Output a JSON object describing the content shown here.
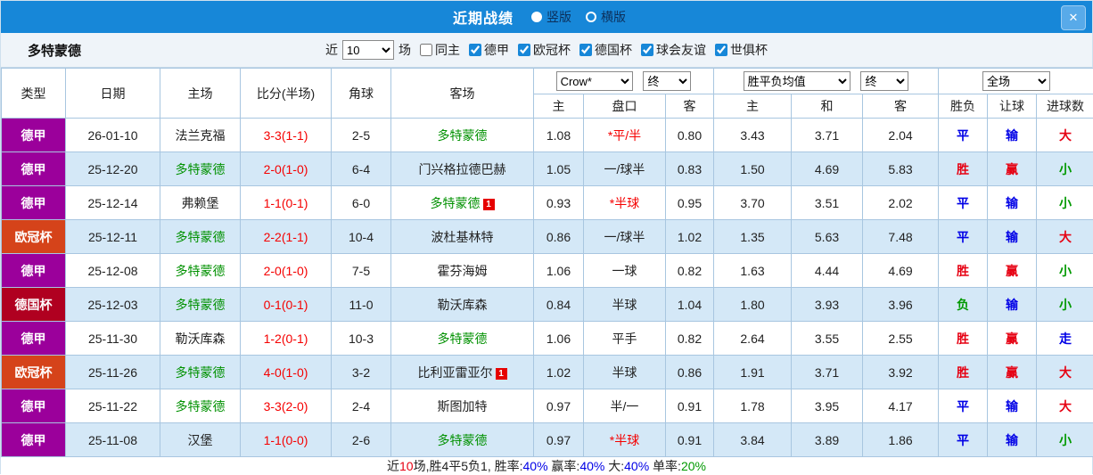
{
  "topbar": {
    "title": "近期战绩",
    "close_glyph": "✕",
    "view_options": [
      {
        "label": "竖版",
        "selected": true
      },
      {
        "label": "横版",
        "selected": false
      }
    ]
  },
  "filterbar": {
    "team": "多特蒙德",
    "near_label": "近",
    "match_count": "10",
    "matches_label": "场",
    "checkboxes": [
      {
        "id": "same-home",
        "label": "同主",
        "checked": false
      },
      {
        "id": "bundesliga",
        "label": "德甲",
        "checked": true
      },
      {
        "id": "champions-league",
        "label": "欧冠杯",
        "checked": true
      },
      {
        "id": "dfb-pokal",
        "label": "德国杯",
        "checked": true
      },
      {
        "id": "club-friendly",
        "label": "球会友谊",
        "checked": true
      },
      {
        "id": "club-world-cup",
        "label": "世俱杯",
        "checked": true
      }
    ]
  },
  "table": {
    "focus_team": "多特蒙德",
    "headers": {
      "type": "类型",
      "date": "日期",
      "home": "主场",
      "score": "比分(半场)",
      "corner": "角球",
      "away": "客场",
      "odds_home": "主",
      "handicap": "盘口",
      "odds_away": "客",
      "avg_home": "主",
      "avg_draw": "和",
      "avg_away": "客",
      "wdl": "胜负",
      "handicap_result": "让球",
      "goals": "进球数"
    },
    "selects": {
      "company": "Crow*",
      "company_stage": "终",
      "avg": "胜平负均值",
      "avg_stage": "终",
      "scope": "全场"
    },
    "league_colors": {
      "德甲": "#9b009b",
      "欧冠杯": "#d5431a",
      "德国杯": "#b00020"
    },
    "result_colors": {
      "胜": "#e60012",
      "平": "#0000e6",
      "负": "#009900",
      "赢": "#e60012",
      "输": "#0000e6",
      "走": "#0000e6",
      "大": "#e60012",
      "小": "#009900"
    },
    "rows": [
      {
        "type": "德甲",
        "date": "26-01-10",
        "home": "法兰克福",
        "score": "3-3(1-1)",
        "corner": "2-5",
        "away": "多特蒙德",
        "away_badge": "",
        "odds_home": "1.08",
        "handicap": "*平/半",
        "odds_away": "0.80",
        "avg_home": "3.43",
        "avg_draw": "3.71",
        "avg_away": "2.04",
        "result_wdl": "平",
        "result_handicap": "输",
        "result_goals": "大"
      },
      {
        "type": "德甲",
        "date": "25-12-20",
        "home": "多特蒙德",
        "score": "2-0(1-0)",
        "corner": "6-4",
        "away": "门兴格拉德巴赫",
        "away_badge": "",
        "odds_home": "1.05",
        "handicap": "一/球半",
        "odds_away": "0.83",
        "avg_home": "1.50",
        "avg_draw": "4.69",
        "avg_away": "5.83",
        "result_wdl": "胜",
        "result_handicap": "赢",
        "result_goals": "小"
      },
      {
        "type": "德甲",
        "date": "25-12-14",
        "home": "弗赖堡",
        "score": "1-1(0-1)",
        "corner": "6-0",
        "away": "多特蒙德",
        "away_badge": "1",
        "odds_home": "0.93",
        "handicap": "*半球",
        "odds_away": "0.95",
        "avg_home": "3.70",
        "avg_draw": "3.51",
        "avg_away": "2.02",
        "result_wdl": "平",
        "result_handicap": "输",
        "result_goals": "小"
      },
      {
        "type": "欧冠杯",
        "date": "25-12-11",
        "home": "多特蒙德",
        "score": "2-2(1-1)",
        "corner": "10-4",
        "away": "波杜基林特",
        "away_badge": "",
        "odds_home": "0.86",
        "handicap": "一/球半",
        "odds_away": "1.02",
        "avg_home": "1.35",
        "avg_draw": "5.63",
        "avg_away": "7.48",
        "result_wdl": "平",
        "result_handicap": "输",
        "result_goals": "大"
      },
      {
        "type": "德甲",
        "date": "25-12-08",
        "home": "多特蒙德",
        "score": "2-0(1-0)",
        "corner": "7-5",
        "away": "霍芬海姆",
        "away_badge": "",
        "odds_home": "1.06",
        "handicap": "一球",
        "odds_away": "0.82",
        "avg_home": "1.63",
        "avg_draw": "4.44",
        "avg_away": "4.69",
        "result_wdl": "胜",
        "result_handicap": "赢",
        "result_goals": "小"
      },
      {
        "type": "德国杯",
        "date": "25-12-03",
        "home": "多特蒙德",
        "score": "0-1(0-1)",
        "corner": "11-0",
        "away": "勒沃库森",
        "away_badge": "",
        "odds_home": "0.84",
        "handicap": "半球",
        "odds_away": "1.04",
        "avg_home": "1.80",
        "avg_draw": "3.93",
        "avg_away": "3.96",
        "result_wdl": "负",
        "result_handicap": "输",
        "result_goals": "小"
      },
      {
        "type": "德甲",
        "date": "25-11-30",
        "home": "勒沃库森",
        "score": "1-2(0-1)",
        "corner": "10-3",
        "away": "多特蒙德",
        "away_badge": "",
        "odds_home": "1.06",
        "handicap": "平手",
        "odds_away": "0.82",
        "avg_home": "2.64",
        "avg_draw": "3.55",
        "avg_away": "2.55",
        "result_wdl": "胜",
        "result_handicap": "赢",
        "result_goals": "走"
      },
      {
        "type": "欧冠杯",
        "date": "25-11-26",
        "home": "多特蒙德",
        "score": "4-0(1-0)",
        "corner": "3-2",
        "away": "比利亚雷亚尔",
        "away_badge": "1",
        "odds_home": "1.02",
        "handicap": "半球",
        "odds_away": "0.86",
        "avg_home": "1.91",
        "avg_draw": "3.71",
        "avg_away": "3.92",
        "result_wdl": "胜",
        "result_handicap": "赢",
        "result_goals": "大"
      },
      {
        "type": "德甲",
        "date": "25-11-22",
        "home": "多特蒙德",
        "score": "3-3(2-0)",
        "corner": "2-4",
        "away": "斯图加特",
        "away_badge": "",
        "odds_home": "0.97",
        "handicap": "半/一",
        "odds_away": "0.91",
        "avg_home": "1.78",
        "avg_draw": "3.95",
        "avg_away": "4.17",
        "result_wdl": "平",
        "result_handicap": "输",
        "result_goals": "大"
      },
      {
        "type": "德甲",
        "date": "25-11-08",
        "home": "汉堡",
        "score": "1-1(0-0)",
        "corner": "2-6",
        "away": "多特蒙德",
        "away_badge": "",
        "odds_home": "0.97",
        "handicap": "*半球",
        "odds_away": "0.91",
        "avg_home": "3.84",
        "avg_draw": "3.89",
        "avg_away": "1.86",
        "result_wdl": "平",
        "result_handicap": "输",
        "result_goals": "小"
      }
    ]
  },
  "summary": {
    "segments": [
      {
        "text": "近",
        "color": "#222222"
      },
      {
        "text": "10",
        "color": "#e60012"
      },
      {
        "text": "场,胜4平5负1, 胜率:",
        "color": "#222222"
      },
      {
        "text": "40%",
        "color": "#0000e6"
      },
      {
        "text": " 赢率:",
        "color": "#222222"
      },
      {
        "text": "40%",
        "color": "#0000e6"
      },
      {
        "text": " 大:",
        "color": "#222222"
      },
      {
        "text": "40%",
        "color": "#0000e6"
      },
      {
        "text": " 单率:",
        "color": "#222222"
      },
      {
        "text": "20%",
        "color": "#009900"
      }
    ]
  }
}
